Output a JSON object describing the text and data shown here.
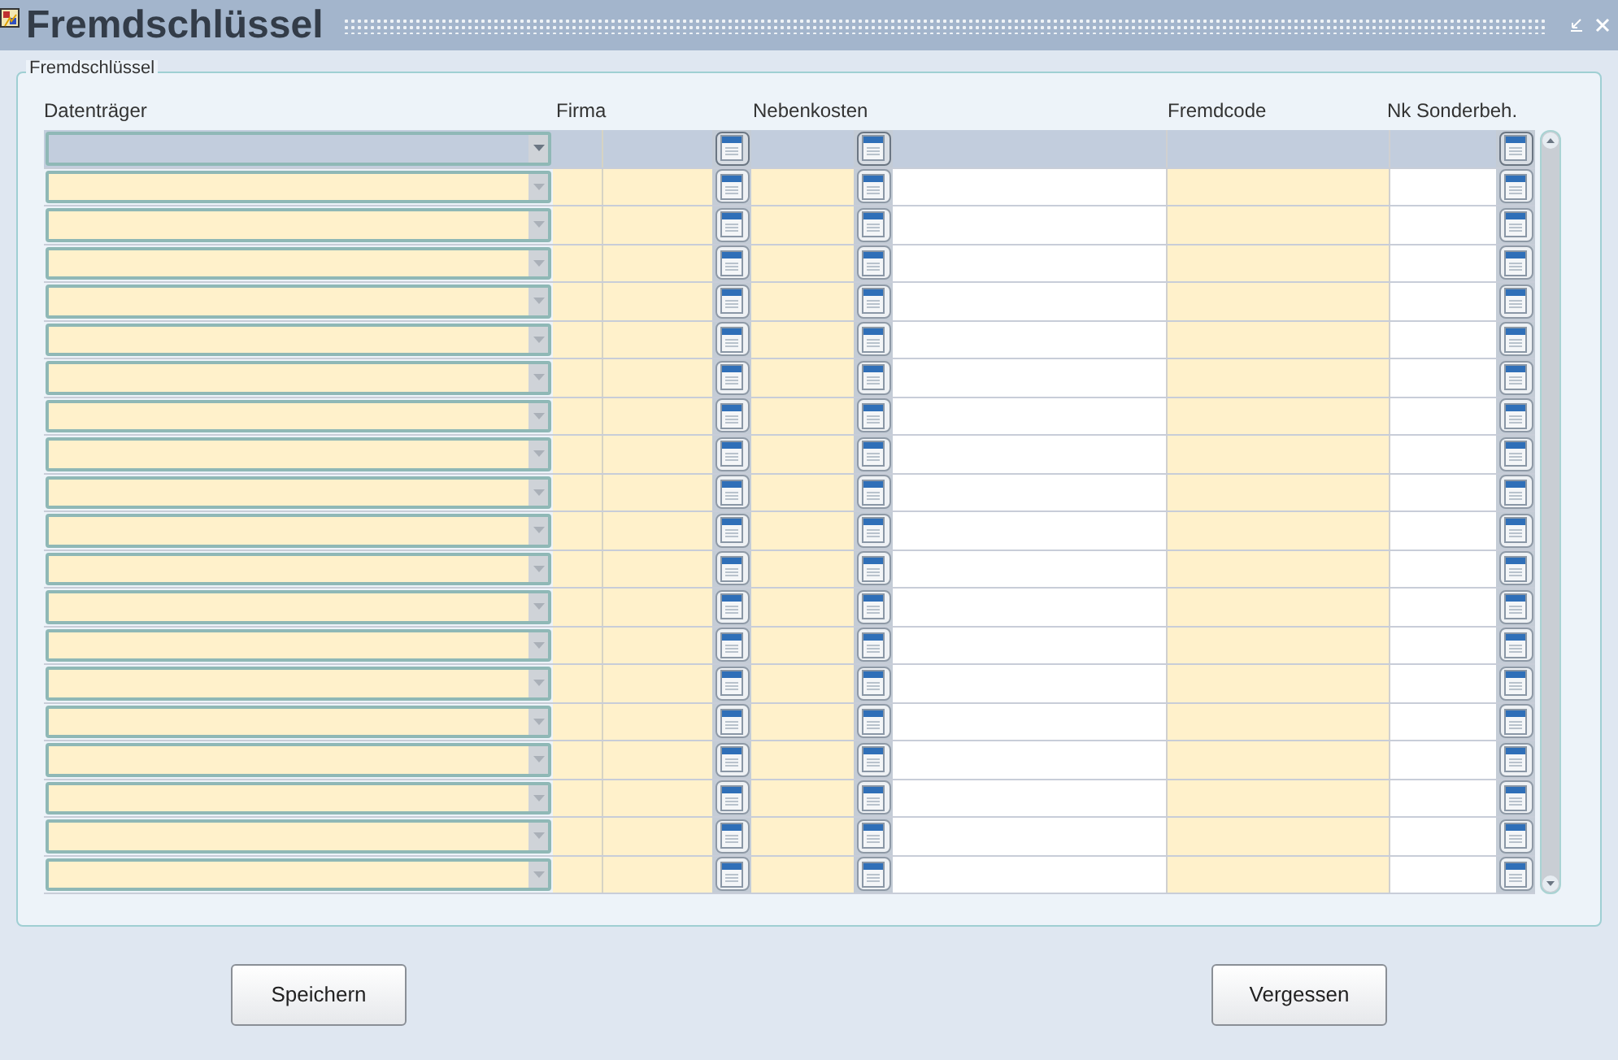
{
  "window": {
    "title": "Fremdschlüssel"
  },
  "group": {
    "title": "Fremdschlüssel"
  },
  "table": {
    "columns": [
      "Datenträger",
      "Firma",
      "Nebenkosten",
      "Fremdcode",
      "Nk Sonderbeh."
    ],
    "rows": [
      {
        "selected": true
      },
      {
        "selected": false
      },
      {
        "selected": false
      },
      {
        "selected": false
      },
      {
        "selected": false
      },
      {
        "selected": false
      },
      {
        "selected": false
      },
      {
        "selected": false
      },
      {
        "selected": false
      },
      {
        "selected": false
      },
      {
        "selected": false
      },
      {
        "selected": false
      },
      {
        "selected": false
      },
      {
        "selected": false
      },
      {
        "selected": false
      },
      {
        "selected": false
      },
      {
        "selected": false
      },
      {
        "selected": false
      },
      {
        "selected": false
      },
      {
        "selected": false
      }
    ]
  },
  "buttons": [
    "Speichern",
    "Vergessen"
  ]
}
